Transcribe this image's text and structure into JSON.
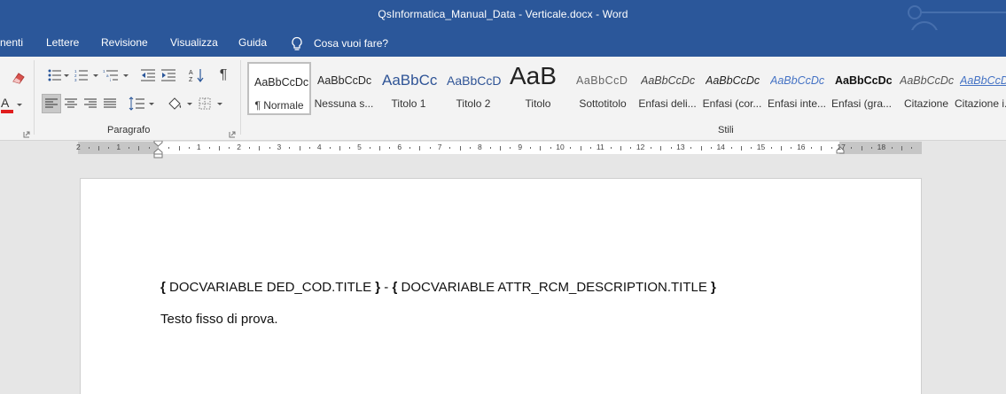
{
  "window": {
    "title": "QsInformatica_Manual_Data - Verticale.docx  -  Word"
  },
  "menu": {
    "tabs": [
      "nenti",
      "Lettere",
      "Revisione",
      "Visualizza",
      "Guida"
    ],
    "tell_me": "Cosa vuoi fare?"
  },
  "ribbon": {
    "groups": {
      "paragraph": "Paragrafo",
      "styles": "Stili"
    },
    "styles": [
      {
        "preview": "AaBbCcDc",
        "name": "¶ Normale",
        "selected": true
      },
      {
        "preview": "AaBbCcDc",
        "name": "Nessuna s..."
      },
      {
        "preview": "AaBbCc",
        "name": "Titolo 1"
      },
      {
        "preview": "AaBbCcD",
        "name": "Titolo 2"
      },
      {
        "preview": "AaB",
        "name": "Titolo"
      },
      {
        "preview": "AaBbCcD",
        "name": "Sottotitolo"
      },
      {
        "preview": "AaBbCcDc",
        "name": "Enfasi deli..."
      },
      {
        "preview": "AaBbCcDc",
        "name": "Enfasi (cor..."
      },
      {
        "preview": "AaBbCcDc",
        "name": "Enfasi inte..."
      },
      {
        "preview": "AaBbCcDc",
        "name": "Enfasi (gra..."
      },
      {
        "preview": "AaBbCcDc",
        "name": "Citazione"
      },
      {
        "preview": "AaBbCcDc",
        "name": "Citazione i..."
      }
    ]
  },
  "ruler": {
    "labels": [
      "2",
      "1",
      "1",
      "2",
      "3",
      "4",
      "5",
      "6",
      "7",
      "8",
      "9",
      "10",
      "11",
      "12",
      "13",
      "14",
      "15",
      "16",
      "17",
      "18"
    ]
  },
  "document": {
    "field_line": {
      "open1": "{",
      "field1": " DOCVARIABLE  DED_COD.TITLE ",
      "close1": "}",
      "sep": " - ",
      "open2": "{",
      "field2": " DOCVARIABLE  ATTR_RCM_DESCRIPTION.TITLE ",
      "close2": "}"
    },
    "paragraph": "Testo fisso di prova."
  },
  "colors": {
    "title_bar": "#2b579a",
    "ribbon": "#f3f3f3",
    "workspace": "#e6e6e6"
  }
}
